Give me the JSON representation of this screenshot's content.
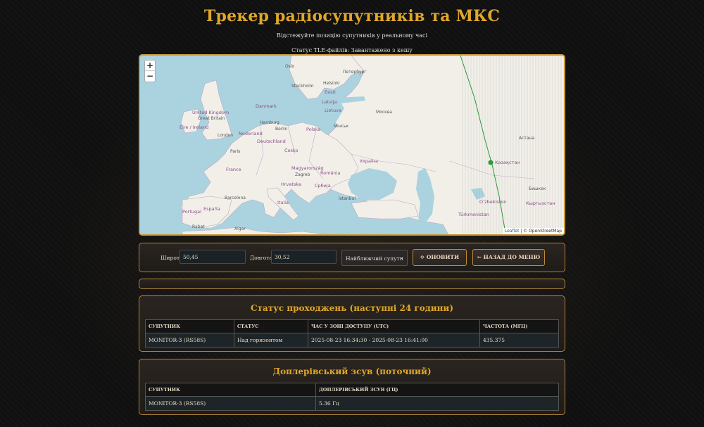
{
  "header": {
    "title": "Трекер радіосупутників та МКС",
    "subtitle": "Відстежуйте позицію супутників у реальному часі",
    "tle_status": "Статус TLE-файлів: Завантажено з кешу"
  },
  "map": {
    "zoom_in": "+",
    "zoom_out": "−",
    "attribution_leaflet": "Leaflet",
    "attribution_osm": "| © OpenStreetMap",
    "labels": {
      "oslo": "Oslo",
      "stockholm": "Stockholm",
      "helsinki": "Helsinki",
      "petersburg": "Петербург",
      "eesti": "Eesti",
      "latvija": "Latvija",
      "danmark": "Danmark",
      "lietuva": "Lietuva",
      "moscow": "Москва",
      "united_kingdom": "United Kingdom",
      "great_britain": "Great Britain",
      "eire": "Éire / Ireland",
      "hamburg": "Hamburg",
      "berlin": "Berlin",
      "polska": "Polska",
      "minsk": "Мінськ",
      "nederland": "Nederland",
      "london": "London",
      "deutschland": "Deutschland",
      "cesko": "Česko",
      "paris": "Paris",
      "ukraina": "Україна",
      "france": "France",
      "magyarorszag": "Magyarország",
      "zagreb": "Zagreb",
      "romania": "România",
      "hrvatska": "Hrvatska",
      "srbija": "Србија",
      "italia": "Italia",
      "barcelona": "Barcelona",
      "istanbul": "İstanbul",
      "portugal": "Portugal",
      "espana": "España",
      "rabat": "Rabat",
      "alger": "Alger",
      "astana": "Астана",
      "kazakhstan": "Қазақстан",
      "bishkek": "Бишкек",
      "uzbekiston": "Oʻzbekiston",
      "kyrgyzstan": "Кыргызстан",
      "turkmenistan": "Türkmenistan"
    }
  },
  "controls": {
    "lat_label": "Широта",
    "lat_value": "50,45",
    "lon_label": "Довгота",
    "lon_value": "30,52",
    "select_value": "Найближчий супутн",
    "refresh_label": "ОНОВИТИ",
    "back_label": "НАЗАД ДО МЕНЮ"
  },
  "pass_table": {
    "title": "Статус проходжень (наступні 24 години)",
    "headers": [
      "СУПУТНИК",
      "СТАТУС",
      "ЧАС У ЗОНІ ДОСТУПУ (UTC)",
      "ЧАСТОТА (МГЦ)"
    ],
    "rows": [
      [
        "MONITOR-3 (RS58S)",
        "Над горизонтом",
        "2025-08-23 16:34:30 - 2025-08-23 16:41:00",
        "435.375"
      ]
    ]
  },
  "doppler_table": {
    "title": "Доплерівський зсув (поточний)",
    "headers": [
      "СУПУТНИК",
      "ДОПЛЕРІВСЬКИЙ ЗСУВ (ГЦ)"
    ],
    "rows": [
      [
        "MONITOR-3 (RS58S)",
        "5.36 Гц"
      ]
    ]
  },
  "colors": {
    "accent": "#e0a72a",
    "border": "#c08a3a",
    "water": "#aad3df",
    "land": "#f2efe9",
    "track": "#2a9a3a"
  }
}
